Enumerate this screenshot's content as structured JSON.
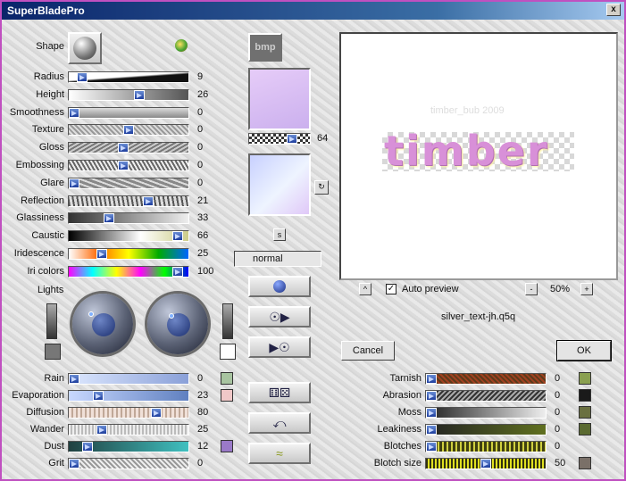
{
  "window": {
    "title": "SuperBladePro",
    "close": "x"
  },
  "shape": {
    "label": "Shape",
    "thumb_label": "bmp"
  },
  "left_sliders": [
    {
      "label": "Radius",
      "value": "9",
      "level": 0.07
    },
    {
      "label": "Height",
      "value": "26",
      "level": 0.6
    },
    {
      "label": "Smoothness",
      "value": "0",
      "level": 0.0
    },
    {
      "label": "Texture",
      "value": "0",
      "level": 0.5
    },
    {
      "label": "Gloss",
      "value": "0",
      "level": 0.45
    },
    {
      "label": "Embossing",
      "value": "0",
      "level": 0.45
    },
    {
      "label": "Glare",
      "value": "0",
      "level": 0.0
    },
    {
      "label": "Reflection",
      "value": "21",
      "level": 0.68
    },
    {
      "label": "Glassiness",
      "value": "33",
      "level": 0.32
    },
    {
      "label": "Caustic",
      "value": "66",
      "level": 0.95
    },
    {
      "label": "Iridescence",
      "value": "25",
      "level": 0.25
    },
    {
      "label": "Iri colors",
      "value": "100",
      "level": 0.95
    }
  ],
  "texture_value": "64",
  "blend_mode": "normal",
  "lights_label": "Lights",
  "bottom_left_sliders": [
    {
      "label": "Rain",
      "value": "0",
      "level": 0.0,
      "swatch": "#a8c4a0"
    },
    {
      "label": "Evaporation",
      "value": "23",
      "level": 0.22,
      "swatch": "#f0c8c8"
    },
    {
      "label": "Diffusion",
      "value": "80",
      "level": 0.75
    },
    {
      "label": "Wander",
      "value": "25",
      "level": 0.25
    },
    {
      "label": "Dust",
      "value": "12",
      "level": 0.12,
      "swatch": "#9a7ac8"
    },
    {
      "label": "Grit",
      "value": "0",
      "level": 0.0
    }
  ],
  "preview": {
    "text": "timber",
    "watermark": "timber_bub 2009",
    "auto_preview_label": "Auto preview",
    "zoom": "50%",
    "filename": "silver_text-jh.q5q"
  },
  "buttons": {
    "cancel": "Cancel",
    "ok": "OK",
    "minus": "-",
    "plus": "+",
    "up": "^",
    "s": "s"
  },
  "right_sliders": [
    {
      "label": "Tarnish",
      "value": "0",
      "level": 0.0,
      "swatch": "#8aa050"
    },
    {
      "label": "Abrasion",
      "value": "0",
      "level": 0.0,
      "swatch": "#1a1a1a"
    },
    {
      "label": "Moss",
      "value": "0",
      "level": 0.0,
      "swatch": "#6a7040"
    },
    {
      "label": "Leakiness",
      "value": "0",
      "level": 0.0,
      "swatch": "#5a6a30"
    },
    {
      "label": "Blotches",
      "value": "0",
      "level": 0.0
    },
    {
      "label": "Blotch size",
      "value": "50",
      "level": 0.5,
      "swatch": "#7a7068"
    }
  ],
  "colors": {
    "gradient_top": "#d8b4f0",
    "gradient_bottom": "#e8f0ff"
  }
}
